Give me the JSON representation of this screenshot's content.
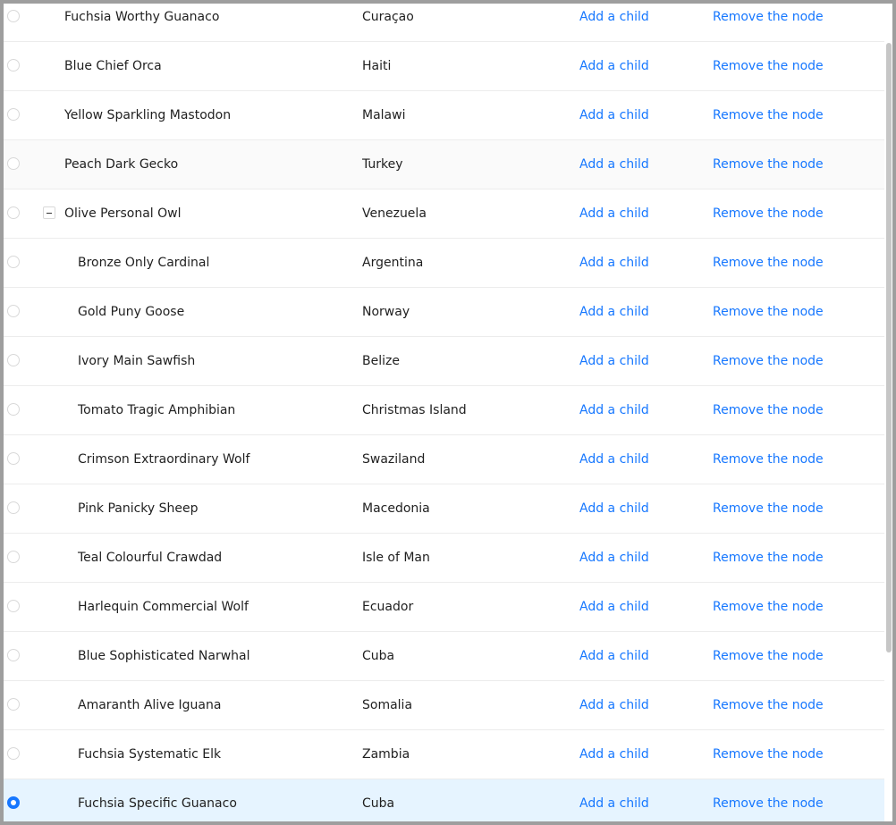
{
  "table": {
    "rows": [
      {
        "name": "Fuchsia Worthy Guanaco",
        "country": "Curaçao",
        "add_label": "Add a child",
        "remove_label": "Remove the node",
        "level": 0,
        "selected": false,
        "expanded": false,
        "hover": false
      },
      {
        "name": "Blue Chief Orca",
        "country": "Haiti",
        "add_label": "Add a child",
        "remove_label": "Remove the node",
        "level": 0,
        "selected": false,
        "expanded": false,
        "hover": false
      },
      {
        "name": "Yellow Sparkling Mastodon",
        "country": "Malawi",
        "add_label": "Add a child",
        "remove_label": "Remove the node",
        "level": 0,
        "selected": false,
        "expanded": false,
        "hover": false
      },
      {
        "name": "Peach Dark Gecko",
        "country": "Turkey",
        "add_label": "Add a child",
        "remove_label": "Remove the node",
        "level": 0,
        "selected": false,
        "expanded": false,
        "hover": true
      },
      {
        "name": "Olive Personal Owl",
        "country": "Venezuela",
        "add_label": "Add a child",
        "remove_label": "Remove the node",
        "level": 0,
        "selected": false,
        "expanded": true,
        "hover": false
      },
      {
        "name": "Bronze Only Cardinal",
        "country": "Argentina",
        "add_label": "Add a child",
        "remove_label": "Remove the node",
        "level": 1,
        "selected": false,
        "expanded": false,
        "hover": false
      },
      {
        "name": "Gold Puny Goose",
        "country": "Norway",
        "add_label": "Add a child",
        "remove_label": "Remove the node",
        "level": 1,
        "selected": false,
        "expanded": false,
        "hover": false
      },
      {
        "name": "Ivory Main Sawfish",
        "country": "Belize",
        "add_label": "Add a child",
        "remove_label": "Remove the node",
        "level": 1,
        "selected": false,
        "expanded": false,
        "hover": false
      },
      {
        "name": "Tomato Tragic Amphibian",
        "country": "Christmas Island",
        "add_label": "Add a child",
        "remove_label": "Remove the node",
        "level": 1,
        "selected": false,
        "expanded": false,
        "hover": false
      },
      {
        "name": "Crimson Extraordinary Wolf",
        "country": "Swaziland",
        "add_label": "Add a child",
        "remove_label": "Remove the node",
        "level": 1,
        "selected": false,
        "expanded": false,
        "hover": false
      },
      {
        "name": "Pink Panicky Sheep",
        "country": "Macedonia",
        "add_label": "Add a child",
        "remove_label": "Remove the node",
        "level": 1,
        "selected": false,
        "expanded": false,
        "hover": false
      },
      {
        "name": "Teal Colourful Crawdad",
        "country": "Isle of Man",
        "add_label": "Add a child",
        "remove_label": "Remove the node",
        "level": 1,
        "selected": false,
        "expanded": false,
        "hover": false
      },
      {
        "name": "Harlequin Commercial Wolf",
        "country": "Ecuador",
        "add_label": "Add a child",
        "remove_label": "Remove the node",
        "level": 1,
        "selected": false,
        "expanded": false,
        "hover": false
      },
      {
        "name": "Blue Sophisticated Narwhal",
        "country": "Cuba",
        "add_label": "Add a child",
        "remove_label": "Remove the node",
        "level": 1,
        "selected": false,
        "expanded": false,
        "hover": false
      },
      {
        "name": "Amaranth Alive Iguana",
        "country": "Somalia",
        "add_label": "Add a child",
        "remove_label": "Remove the node",
        "level": 1,
        "selected": false,
        "expanded": false,
        "hover": false
      },
      {
        "name": "Fuchsia Systematic Elk",
        "country": "Zambia",
        "add_label": "Add a child",
        "remove_label": "Remove the node",
        "level": 1,
        "selected": false,
        "expanded": false,
        "hover": false
      },
      {
        "name": "Fuchsia Specific Guanaco",
        "country": "Cuba",
        "add_label": "Add a child",
        "remove_label": "Remove the node",
        "level": 1,
        "selected": true,
        "expanded": false,
        "hover": false
      }
    ]
  },
  "colors": {
    "link": "#1677ff",
    "selected_row": "#e6f4ff",
    "hover_row": "#fafafa",
    "border": "#ececec",
    "backdrop": "#9e9e9e"
  }
}
